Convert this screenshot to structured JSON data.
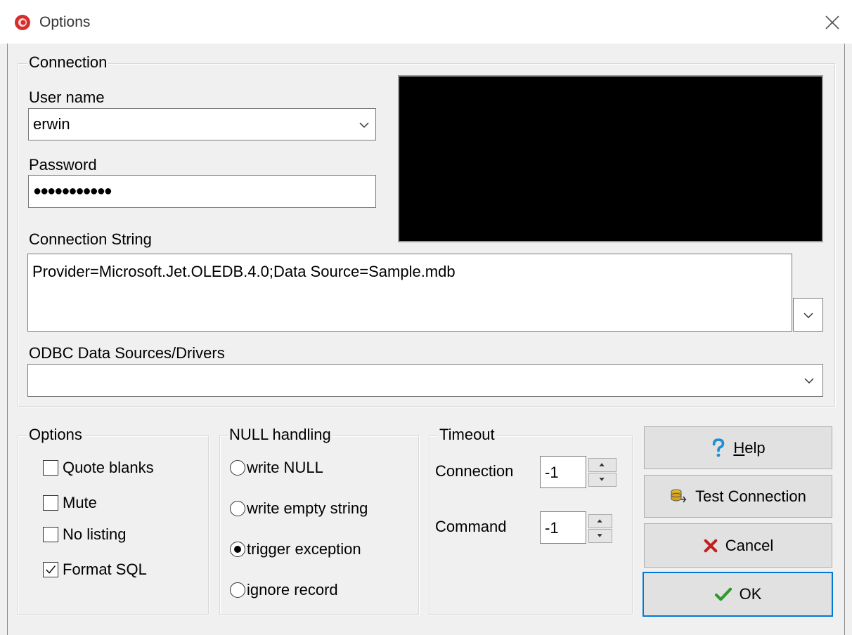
{
  "window": {
    "title": "Options",
    "icon": "app-icon",
    "close_icon": "close-icon"
  },
  "connection": {
    "legend": "Connection",
    "username_label": "User name",
    "username_value": "erwin",
    "password_label": "Password",
    "password_value": "●●●●●●●●●●●",
    "connstring_label": "Connection String",
    "connstring_value": "Provider=Microsoft.Jet.OLEDB.4.0;Data Source=Sample.mdb",
    "odbc_label": "ODBC Data Sources/Drivers",
    "odbc_value": ""
  },
  "options": {
    "legend": "Options",
    "items": [
      {
        "label": "Quote blanks",
        "checked": false
      },
      {
        "label": "Mute",
        "checked": false
      },
      {
        "label": "No listing",
        "checked": false
      },
      {
        "label": "Format SQL",
        "checked": true
      }
    ]
  },
  "null_handling": {
    "legend": "NULL handling",
    "items": [
      {
        "label": "write NULL",
        "selected": false
      },
      {
        "label": "write empty string",
        "selected": false
      },
      {
        "label": "trigger exception",
        "selected": true
      },
      {
        "label": "ignore record",
        "selected": false
      }
    ]
  },
  "timeout": {
    "legend": "Timeout",
    "connection_label": "Connection",
    "connection_value": "-1",
    "command_label": "Command",
    "command_value": "-1"
  },
  "buttons": {
    "help": {
      "label_mnemonic": "H",
      "label_rest": "elp",
      "icon": "help-icon"
    },
    "test": {
      "label": "Test Connection",
      "icon": "database-icon"
    },
    "cancel": {
      "label": "Cancel",
      "icon": "cross-icon"
    },
    "ok": {
      "label": "OK",
      "icon": "checkmark-icon"
    }
  },
  "colors": {
    "accent": "#0078d7",
    "help_icon": "#1c8fd6",
    "cancel_icon": "#c0201c",
    "ok_icon": "#2e9a2e"
  }
}
